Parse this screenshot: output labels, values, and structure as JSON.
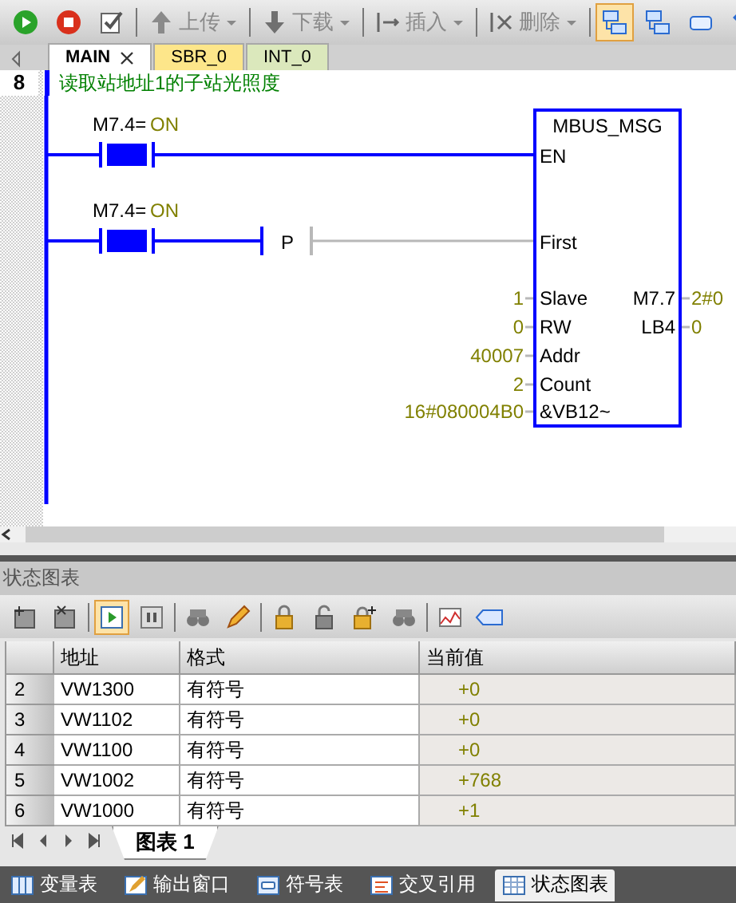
{
  "toolbar": {
    "items": [
      {
        "kind": "run",
        "selected": false
      },
      {
        "kind": "stop",
        "selected": false
      },
      {
        "kind": "compile",
        "selected": false
      },
      {
        "kind": "upload",
        "label": "上传",
        "disabled": true,
        "selected": false
      },
      {
        "kind": "download",
        "label": "下载",
        "disabled": true,
        "selected": false
      },
      {
        "kind": "insert",
        "label": "插入",
        "disabled": true,
        "selected": false
      },
      {
        "kind": "delete",
        "label": "删除",
        "disabled": true,
        "selected": false
      },
      {
        "kind": "network",
        "selected": true
      },
      {
        "kind": "network",
        "selected": false
      },
      {
        "kind": "box",
        "selected": false
      },
      {
        "kind": "back",
        "selected": false
      }
    ]
  },
  "tabs": [
    {
      "label": "MAIN",
      "selected": true,
      "color": "#ffffff"
    },
    {
      "label": "SBR_0",
      "selected": false,
      "color": "#fde68a"
    },
    {
      "label": "INT_0",
      "selected": false,
      "color": "#dbe8bc"
    }
  ],
  "network": {
    "number": "8",
    "comment": "读取站地址1的子站光照度",
    "contacts": [
      {
        "address": "M7.4=",
        "state": "ON",
        "energized": true
      },
      {
        "address": "M7.4=",
        "state": "ON",
        "energized": true
      }
    ],
    "transition": {
      "label": "P",
      "powered": false
    },
    "block": {
      "title": "MBUS_MSG",
      "inputs": [
        {
          "pin": "EN"
        },
        {
          "pin": "First"
        },
        {
          "pin": "Slave",
          "value": "1"
        },
        {
          "pin": "RW",
          "value": "0"
        },
        {
          "pin": "Addr",
          "value": "40007"
        },
        {
          "pin": "Count",
          "value": "2"
        },
        {
          "pin": "&VB12~",
          "value": "16#080004B0"
        }
      ],
      "outputs": [
        {
          "pin": "M7.7",
          "value": "2#0"
        },
        {
          "pin": "LB4",
          "value": "0"
        }
      ]
    }
  },
  "status_chart": {
    "title": "状态图表",
    "toolbar": [
      {
        "kind": "add-row",
        "selected": false
      },
      {
        "kind": "delete-row",
        "selected": false
      },
      {
        "kind": "start",
        "selected": true
      },
      {
        "kind": "pause",
        "selected": false
      },
      {
        "kind": "glasses",
        "selected": false
      },
      {
        "kind": "pencil",
        "selected": false
      },
      {
        "kind": "lock",
        "selected": false
      },
      {
        "kind": "unlock",
        "selected": false
      },
      {
        "kind": "lock-add",
        "selected": false
      },
      {
        "kind": "glasses",
        "selected": false
      },
      {
        "kind": "trend",
        "selected": false
      },
      {
        "kind": "tag",
        "selected": false
      }
    ],
    "columns": [
      "地址",
      "格式",
      "当前值"
    ],
    "rows": [
      {
        "index": "2",
        "address": "VW1300",
        "format": "有符号",
        "value": "+0"
      },
      {
        "index": "3",
        "address": "VW1102",
        "format": "有符号",
        "value": "+0"
      },
      {
        "index": "4",
        "address": "VW1100",
        "format": "有符号",
        "value": "+0"
      },
      {
        "index": "5",
        "address": "VW1002",
        "format": "有符号",
        "value": "+768"
      },
      {
        "index": "6",
        "address": "VW1000",
        "format": "有符号",
        "value": "+1"
      }
    ],
    "sheets": [
      {
        "label": "图表 1",
        "selected": true
      }
    ]
  },
  "bottom_tabs": [
    {
      "label": "变量表",
      "selected": false,
      "kind": "table"
    },
    {
      "label": "输出窗口",
      "selected": false,
      "kind": "output"
    },
    {
      "label": "符号表",
      "selected": false,
      "kind": "symbol"
    },
    {
      "label": "交叉引用",
      "selected": false,
      "kind": "xref"
    },
    {
      "label": "状态图表",
      "selected": true,
      "kind": "chart"
    }
  ]
}
